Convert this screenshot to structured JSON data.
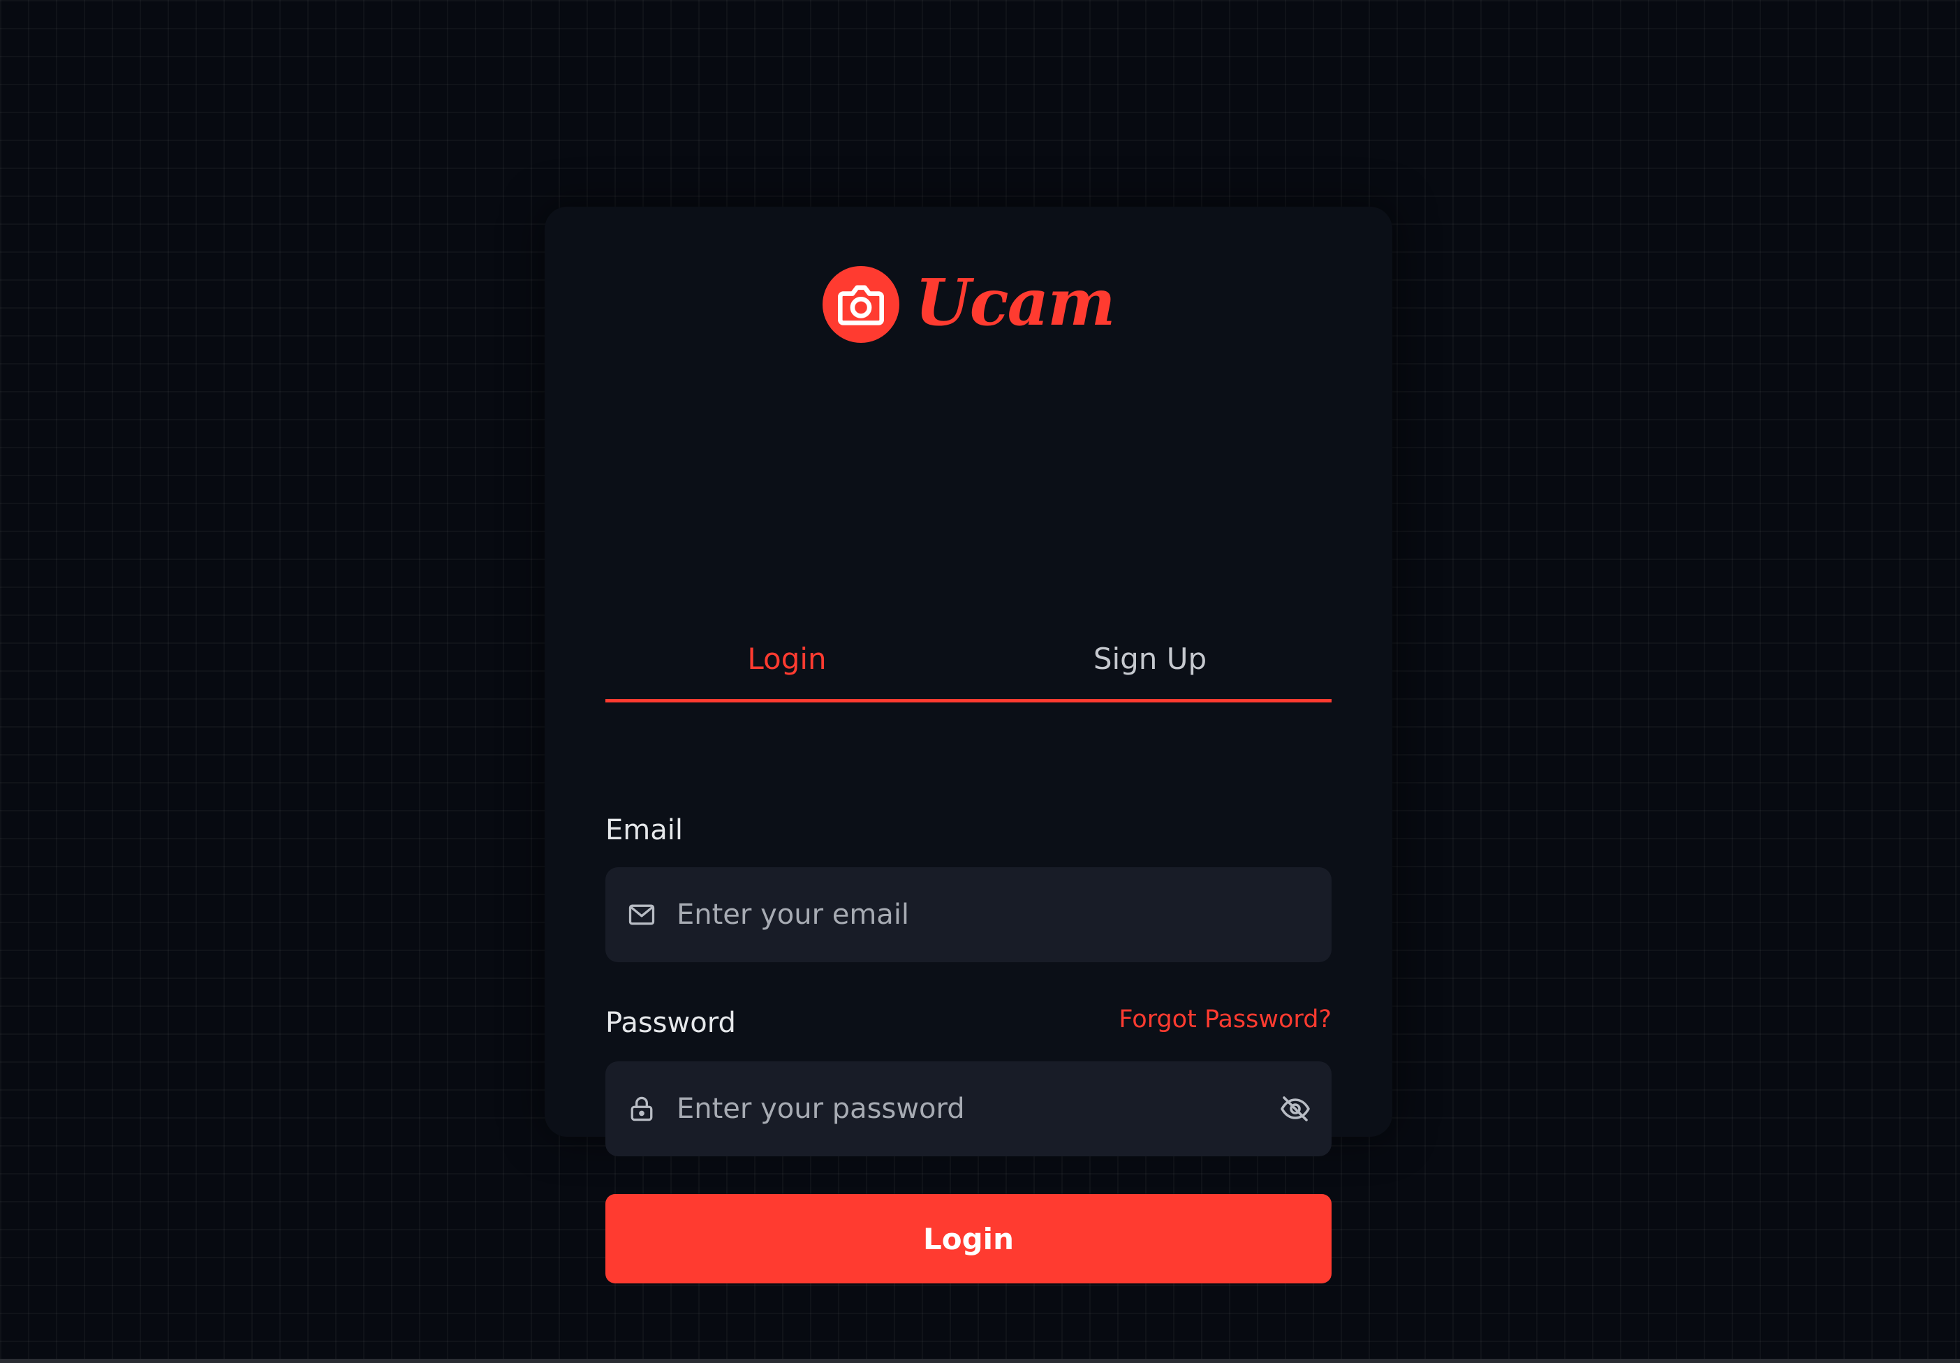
{
  "brand": {
    "name": "Ucam",
    "logo_icon": "camera-icon",
    "accent_color": "#ff3b30"
  },
  "tabs": [
    {
      "label": "Login",
      "active": true
    },
    {
      "label": "Sign Up",
      "active": false
    }
  ],
  "form": {
    "email": {
      "label": "Email",
      "placeholder": "Enter your email",
      "value": "",
      "icon": "mail-icon"
    },
    "password": {
      "label": "Password",
      "placeholder": "Enter your password",
      "value": "",
      "icon": "lock-icon",
      "toggle_icon": "eye-off-icon"
    },
    "forgot_password": "Forgot Password?",
    "submit_label": "Login"
  }
}
